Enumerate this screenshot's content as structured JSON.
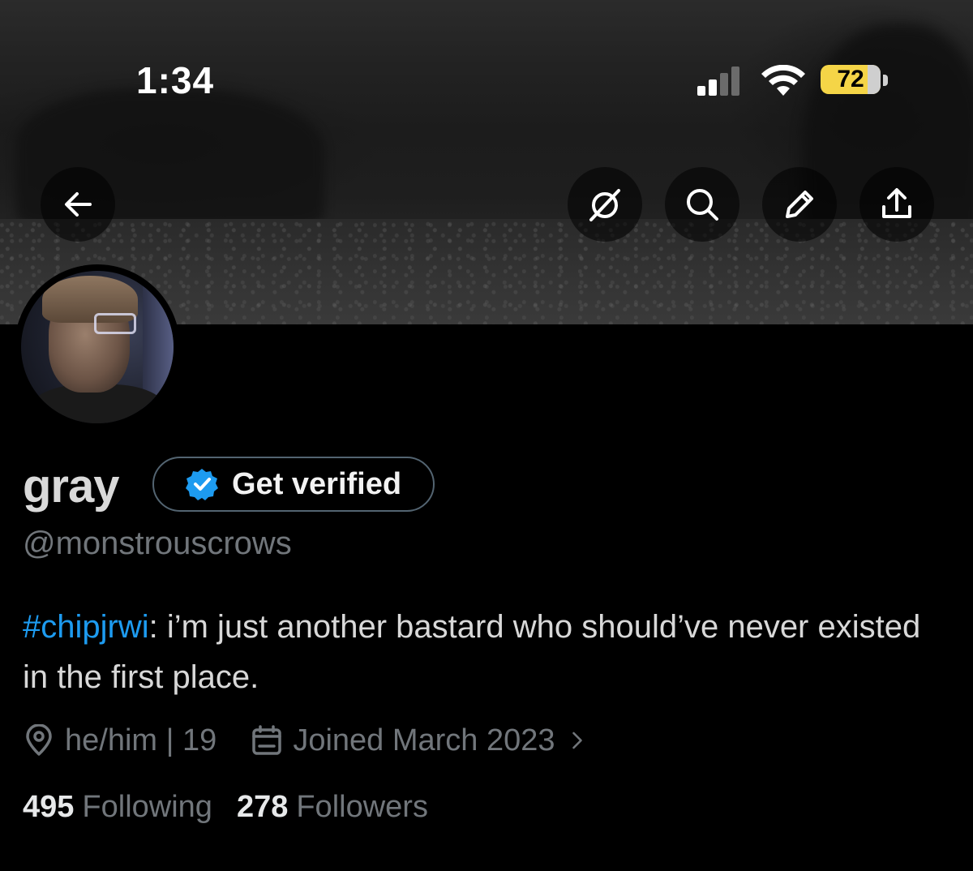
{
  "status_bar": {
    "time": "1:34",
    "battery": "72",
    "battery_color": "#f5d547"
  },
  "header_actions": {
    "back_icon": "arrow-left-icon",
    "grok_icon": "grok-icon",
    "search_icon": "search-icon",
    "edit_icon": "pencil-icon",
    "share_icon": "share-icon"
  },
  "profile": {
    "display_name": "gray",
    "verify_label": "Get verified",
    "handle": "@monstrouscrows",
    "bio_hashtag": "#chipjrwi",
    "bio_text": ": i’m just another bastard who should’ve never existed in the first place.",
    "location": "he/him | 19",
    "joined": "Joined March 2023",
    "following_count": "495",
    "following_label": "Following",
    "followers_count": "278",
    "followers_label": "Followers"
  },
  "colors": {
    "accent": "#1d9bf0",
    "secondary_text": "#71767b",
    "background": "#000000"
  }
}
